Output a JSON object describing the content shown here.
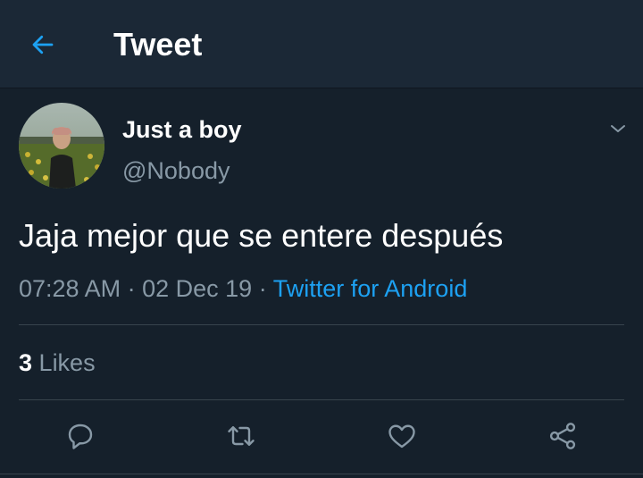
{
  "header": {
    "title": "Tweet",
    "back_icon": "arrow-left-icon"
  },
  "tweet": {
    "display_name": "Just a boy",
    "handle": "@Nobody",
    "text": "Jaja mejor que se entere después",
    "time": "07:28 AM",
    "separator": "·",
    "date": "02 Dec 19",
    "source": "Twitter for Android",
    "likes_count": "3",
    "likes_label": "Likes"
  },
  "actions": [
    {
      "icon": "reply-icon"
    },
    {
      "icon": "retweet-icon"
    },
    {
      "icon": "like-icon"
    },
    {
      "icon": "share-icon"
    }
  ],
  "colors": {
    "background": "#15202b",
    "header_background": "#1b2836",
    "accent": "#1da1f2",
    "secondary_text": "#8899a6",
    "divider": "#38444d"
  }
}
